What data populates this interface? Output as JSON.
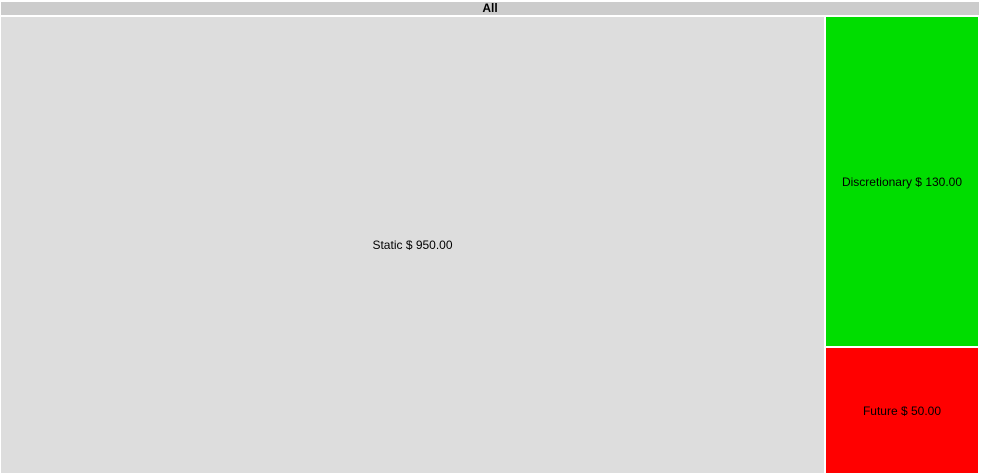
{
  "chart_data": {
    "type": "treemap",
    "title": "All",
    "currency": "$",
    "items": [
      {
        "label": "Static",
        "value": 950.0,
        "value_text": "$ 950.00",
        "color": "#dddddd"
      },
      {
        "label": "Discretionary",
        "value": 130.0,
        "value_text": "$ 130.00",
        "color": "#00dd00"
      },
      {
        "label": "Future",
        "value": 50.0,
        "value_text": "$ 50.00",
        "color": "#ff0000"
      }
    ],
    "border_color": "#ffffff",
    "header_color": "#cccccc"
  }
}
